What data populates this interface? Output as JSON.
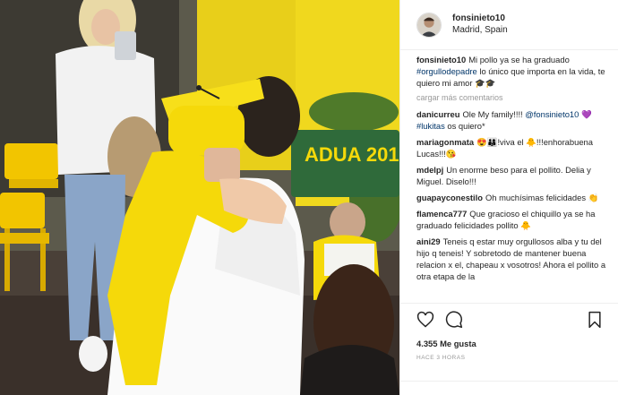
{
  "post": {
    "username": "fonsinieto10",
    "location": "Madrid, Spain",
    "caption_user": "fonsinieto10",
    "caption_text_1": "Mi pollo ya se ha graduado",
    "caption_hashtag": "#orgullodepadre",
    "caption_text_2": "lo único que importa en la vida, te quiero mi amor 🎓🎓",
    "load_more": "cargar más comentarios",
    "likes": "4.355 Me gusta",
    "time": "HACE 3 HORAS"
  },
  "photo": {
    "banner_text": "ADUA  201"
  },
  "comments": [
    {
      "user": "danicurreu",
      "text": "Ole My family!!!! @fonsinieto10 💜 #lukitas os quiero*"
    },
    {
      "user": "mariagonmata",
      "text": "😍👨‍👩‍👦!viva el 🐥!!!enhorabuena Lucas!!!😘"
    },
    {
      "user": "mdelpj",
      "text": "Un enorme beso para el pollito. Delia y Miguel. Diselo!!!"
    },
    {
      "user": "guapayconestilo",
      "text": "Oh muchísimas felicidades 👏"
    },
    {
      "user": "flamenca777",
      "text": "Que gracioso el chiquillo ya se ha graduado felicidades pollito 🐥"
    },
    {
      "user": "aini29",
      "text": "Teneis q estar muy orgullosos alba y tu del hijo q teneis! Y sobretodo de mantener buena relacion x el, chapeau x vosotros! Ahora el pollito a otra etapa de la"
    }
  ],
  "icons": [
    "heart-icon",
    "comment-icon",
    "bookmark-icon"
  ],
  "colors": {
    "link": "#003569",
    "muted": "#999999",
    "gown": "#f5d90a"
  }
}
